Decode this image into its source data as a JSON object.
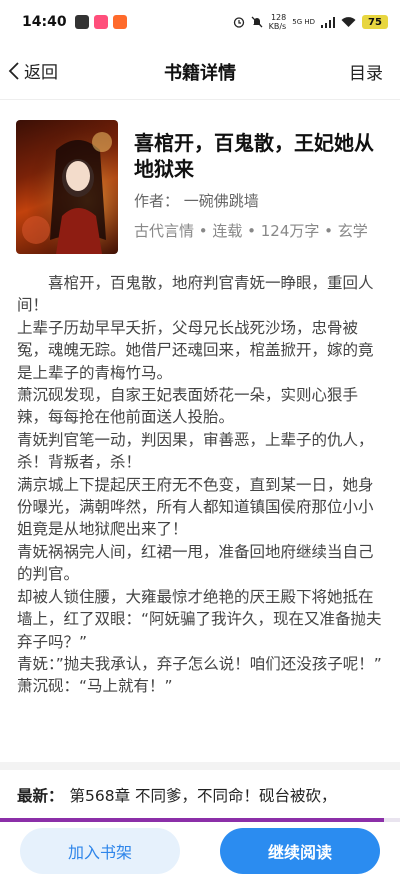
{
  "status_bar": {
    "time": "14:40",
    "net_speed_value": "128",
    "net_speed_unit": "KB/s",
    "network": "5G HD",
    "battery": "75"
  },
  "nav": {
    "back_label": "返回",
    "title": "书籍详情",
    "catalog_label": "目录"
  },
  "book": {
    "title": "喜棺开，百鬼散，王妃她从地狱来",
    "author": "作者：  一碗佛跳墙",
    "meta": "古代言情 • 连载 • 124万字 • 玄学",
    "cover_text": "喜棺开百鬼散",
    "cover_subtitle": "王妃她从地狱来"
  },
  "synopsis": [
    "喜棺开，百鬼散，地府判官青妩一睁眼，重回人间！",
    "上辈子历劫早早夭折，父母兄长战死沙场，忠骨被冤，魂魄无踪。她借尸还魂回来，棺盖掀开，嫁的竟是上辈子的青梅竹马。",
    "萧沉砚发现，自家王妃表面娇花一朵，实则心狠手辣，每每抢在他前面送人投胎。",
    "青妩判官笔一动，判因果，审善恶，上辈子的仇人，杀！背叛者，杀！",
    "满京城上下提起厌王府无不色变，直到某一日，她身份曝光，满朝哗然，所有人都知道镇国侯府那位小小姐竟是从地狱爬出来了！",
    "青妩祸祸完人间，红裙一甩，准备回地府继续当自己的判官。",
    "却被人锁住腰，大雍最惊才绝艳的厌王殿下将她抵在墙上，红了双眼：“阿妩骗了我许久，现在又准备抛夫弃子吗？”",
    "青妩：”抛夫我承认，弃子怎么说！咱们还没孩子呢！”",
    "萧沉砚：“马上就有！”"
  ],
  "latest": {
    "label": "最新：",
    "chapter": "第568章  不同爹，不同命！砚台被砍，"
  },
  "reading_progress": 0.96,
  "actions": {
    "add_shelf": "加入书架",
    "continue_reading": "继续阅读"
  },
  "colors": {
    "accent": "#2b8cf0",
    "accent_light": "#e6f1fc",
    "progress": "#8b2fa8",
    "battery": "#e8d640"
  }
}
